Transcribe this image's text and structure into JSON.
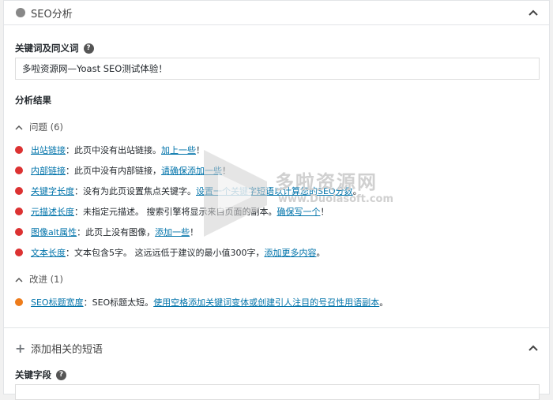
{
  "seo": {
    "title": "SEO分析",
    "keyword_label": "关键词及同义词",
    "keyword_value": "多啦资源网—Yoast SEO测试体验！",
    "results_label": "分析结果",
    "problems_header": "问题 (6)",
    "problems": [
      {
        "link": "出站链接",
        "text": "：此页中没有出站链接。",
        "action": "加上一些",
        "tail": "！"
      },
      {
        "link": "内部链接",
        "text": "：此页中没有内部链接，",
        "action": "请确保添加一些",
        "tail": "！"
      },
      {
        "link": "关键字长度",
        "text": "：没有为此页设置焦点关键字。",
        "action": "设置一个关键字短语以计算您的SEO分数",
        "tail": "。"
      },
      {
        "link": "元描述长度",
        "text": "：未指定元描述。 搜索引擎将显示来自页面的副本。",
        "action": "确保写一个",
        "tail": "！"
      },
      {
        "link": "图像alt属性",
        "text": "：此页上没有图像，",
        "action": "添加一些",
        "tail": "！"
      },
      {
        "link": "文本长度",
        "text": "：文本包含5字。 这远远低于建议的最小值300字，",
        "action": "添加更多内容",
        "tail": "。"
      }
    ],
    "improvements_header": "改进 (1)",
    "improvements": [
      {
        "link": "SEO标题宽度",
        "text": "：SEO标题太短。",
        "action": "使用空格添加关键词变体或创建引人注目的号召性用语副本",
        "tail": "。"
      }
    ]
  },
  "related": {
    "title": "添加相关的短语",
    "keyword_label": "关键字段"
  },
  "watermark": {
    "name": "多啦资源网",
    "url": "www.Duolasoft.com"
  },
  "colors": {
    "problem": "#dc3232",
    "improvement": "#ee7c1b",
    "link": "#0073aa"
  }
}
